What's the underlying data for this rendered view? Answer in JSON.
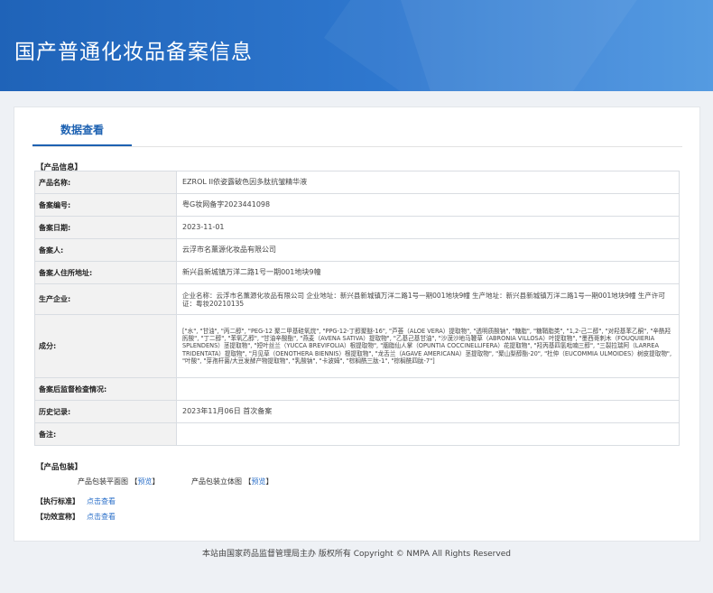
{
  "header": {
    "title": "国产普通化妆品备案信息"
  },
  "tabs": [
    {
      "label": "数据查看"
    }
  ],
  "product_info": {
    "section_title": "【产品信息】",
    "rows": [
      {
        "label": "产品名称:",
        "value": "EZROL II依姿露破色因多肽抗皱精华液"
      },
      {
        "label": "备案编号:",
        "value": "粤G妆网备字2023441098"
      },
      {
        "label": "备案日期:",
        "value": "2023-11-01"
      },
      {
        "label": "备案人:",
        "value": "云浮市名薰源化妆品有限公司"
      },
      {
        "label": "备案人住所地址:",
        "value": "新兴县新城镇万洋二路1号一期001地块9幢"
      },
      {
        "label": "生产企业:",
        "value": "企业名称：云浮市名薰源化妆品有限公司 企业地址：新兴县新城镇万洋二路1号一期001地块9幢 生产地址：新兴县新城镇万洋二路1号一期001地块9幢 生产许可证：粤妆20210135"
      },
      {
        "label": "成分:",
        "value": "[\"水\", \"甘油\", \"丙二醇\", \"PEG-12 聚二甲基硅氧烷\", \"PPG-12-丁醇聚醚-16\", \"芦荟（ALOE VERA）提取物\", \"透明质酸钠\", \"糖脂\", \"糖鞘脂类\", \"1,2-己二醇\", \"对羟基苯乙酮\", \"辛酰羟肟酸\", \"丁二醇\", \"苯氧乙醇\", \"甘油辛酸酯\", \"燕麦（AVENA SATIVA）提取物\", \"乙基己基甘油\", \"沙漠沙地马鞭草（ABRONIA VILLOSA）叶提取物\", \"墨西哥刺木（FOUQUIERIA SPLENDENS）茎提取物\", \"短叶丝兰（YUCCA BREVIFOLIA）根提取物\", \"胭脂仙人掌（OPUNTIA COCCINELLIFERA）花提取物\", \"羟丙基四氢吡喃三醇\", \"三裂拉瑞阿（LARREA TRIDENTATA）提取物\", \"月见草（OENOTHERA BIENNIS）根提取物\", \"龙舌兰（AGAVE AMERICANA）茎提取物\", \"聚山梨醇酯-20\", \"杜仲（EUCOMMIA ULMOIDES）树皮提取物\", \"叶酸\", \"芽孢杆菌/大豆发酵产物提取物\", \"乳酸钠\", \"卡波姆\", \"棕榈酰三肽-1\", \"棕榈酰四肽-7\"]"
      },
      {
        "label": "备案后监督检查情况:",
        "value": ""
      },
      {
        "label": "历史记录:",
        "value": "2023年11月06日 首次备案"
      },
      {
        "label": "备注:",
        "value": ""
      }
    ]
  },
  "packaging": {
    "section_title": "【产品包装】",
    "flat_label": "产品包装平面图",
    "solid_label": "产品包装立体图",
    "preview_link": "预览",
    "bracket_open": "【",
    "bracket_close": "】"
  },
  "standards": {
    "label": "【执行标准】",
    "link": "点击查看"
  },
  "efficacy": {
    "label": "【功效宣称】",
    "link": "点击查看"
  },
  "footer": {
    "text": "本站由国家药品监督管理局主办 版权所有 Copyright © NMPA All Rights Reserved"
  },
  "colors": {
    "banner": "#2f78cf",
    "accent": "#1e62b2",
    "link": "#2a6fc9"
  }
}
